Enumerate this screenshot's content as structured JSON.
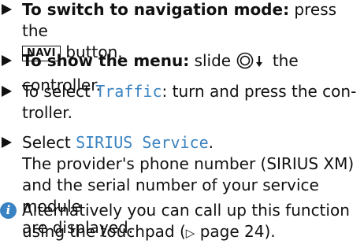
{
  "steps": [
    {
      "lead": "To switch to navigation mode:",
      "text_before_key": " press the",
      "key": "NAVI",
      "text_after_key": " button."
    },
    {
      "lead": "To show the menu:",
      "text_before_icon": " slide ",
      "text_after_icon": " the controller."
    },
    {
      "text_before": "To select ",
      "highlight": "Traffic",
      "text_after_line1": ": turn and press the con-",
      "text_line2": "troller."
    },
    {
      "text_before": "Select ",
      "highlight": "SIRIUS Service",
      "text_after": ".",
      "lines": [
        "The provider's phone number (SIRIUS XM)",
        "and the serial number of your service module",
        "are displayed."
      ]
    }
  ],
  "note": {
    "icon": "info-icon",
    "icon_glyph": "i",
    "line1": "Alternatively you can call up this function",
    "line2_before": "using the touchpad (",
    "ref_glyph": "▷",
    "line2_after": " page 24)."
  },
  "colors": {
    "accent": "#3a83c2",
    "text": "#111111"
  }
}
